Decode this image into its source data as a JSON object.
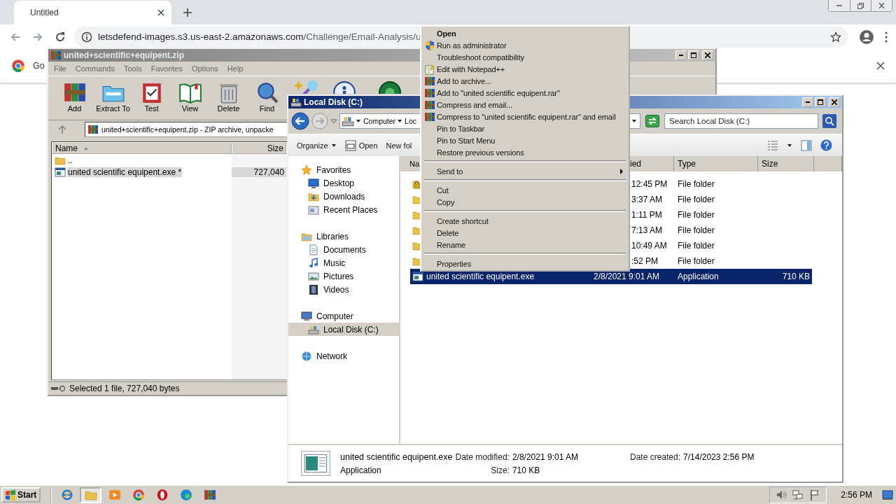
{
  "browser": {
    "tab": {
      "title": "Untitled"
    },
    "address": {
      "host": "letsdefend-images.s3.us-east-2.amazonaws.com",
      "path": "/Challenge/Email-Analysis/u"
    },
    "infobar": {
      "text": "Go"
    }
  },
  "archiver": {
    "title": "united+scientific+equipent.zip",
    "active": false,
    "menu": [
      "File",
      "Commands",
      "Tools",
      "Favorites",
      "Options",
      "Help"
    ],
    "toolbar": [
      {
        "kind": "add",
        "label": "Add"
      },
      {
        "kind": "extract",
        "label": "Extract To"
      },
      {
        "kind": "test",
        "label": "Test"
      },
      {
        "kind": "view",
        "label": "View"
      },
      {
        "kind": "delete",
        "label": "Delete"
      },
      {
        "kind": "find",
        "label": "Find"
      },
      {
        "kind": "wizard"
      },
      {
        "kind": "info"
      },
      {
        "kind": "virus"
      }
    ],
    "path": "united+scientific+equipent.zip - ZIP archive, unpacke",
    "columns": [
      "Name",
      "Size"
    ],
    "rows": [
      {
        "kind": "folder",
        "name": "..",
        "selected": false
      },
      {
        "kind": "app",
        "name": "united scientific equipent.exe *",
        "size": "727,040",
        "selected": true
      }
    ],
    "status": "Selected 1 file, 727,040 bytes"
  },
  "explorer": {
    "title": "Local Disk (C:)",
    "active": true,
    "breadcrumb": [
      "Computer",
      "Loc"
    ],
    "search": {
      "placeholder": "Search Local Disk (C:)"
    },
    "commands": [
      {
        "kind": "menu",
        "label": "Organize"
      },
      {
        "kind": "open",
        "label": "Open"
      },
      {
        "kind": "plain",
        "label": "New fol"
      }
    ],
    "nav": [
      {
        "kind": "favorites",
        "label": "Favorites",
        "selected": false,
        "children": [
          {
            "kind": "desktop",
            "label": "Desktop",
            "selected": false
          },
          {
            "kind": "downloads",
            "label": "Downloads",
            "selected": false
          },
          {
            "kind": "recent",
            "label": "Recent Places",
            "selected": false
          }
        ]
      },
      {
        "kind": "libraries",
        "label": "Libraries",
        "selected": false,
        "children": [
          {
            "kind": "documents",
            "label": "Documents",
            "selected": false
          },
          {
            "kind": "music",
            "label": "Music",
            "selected": false
          },
          {
            "kind": "pictures",
            "label": "Pictures",
            "selected": false
          },
          {
            "kind": "videos",
            "label": "Videos",
            "selected": false
          }
        ]
      },
      {
        "kind": "computer",
        "label": "Computer",
        "selected": false,
        "children": [
          {
            "kind": "drive",
            "label": "Local Disk (C:)",
            "selected": true
          }
        ]
      },
      {
        "kind": "network",
        "label": "Network",
        "selected": false
      }
    ],
    "columns": [
      "Na",
      "ied",
      "Type",
      "Size"
    ],
    "rows": [
      {
        "kind": "locked",
        "modified": "12:45 PM",
        "type": "File folder",
        "selected": false
      },
      {
        "kind": "folder",
        "modified": "3:37 AM",
        "type": "File folder",
        "selected": false
      },
      {
        "kind": "folder",
        "modified": "1:11 PM",
        "type": "File folder",
        "selected": false
      },
      {
        "kind": "folder",
        "modified": "7:13 AM",
        "type": "File folder",
        "selected": false
      },
      {
        "kind": "folder",
        "modified": "10:49 AM",
        "type": "File folder",
        "selected": false
      },
      {
        "kind": "folder",
        "modified": ":52 PM",
        "type": "File folder",
        "selected": false
      },
      {
        "kind": "app",
        "name": "united scientific equipent.exe",
        "modified": "2/8/2021 9:01 AM",
        "type": "Application",
        "size": "710 KB",
        "selected": true
      }
    ],
    "details": {
      "name": "united scientific equipent.exe",
      "type": "Application",
      "fields": [
        {
          "label": "Date modified:",
          "value": "2/8/2021 9:01 AM"
        },
        {
          "label": "Date created:",
          "value": "7/14/2023 2:56 PM"
        },
        {
          "label": "Size:",
          "value": "710 KB"
        }
      ]
    }
  },
  "context_menu": {
    "items": [
      {
        "kind": "plain",
        "label": "Open",
        "default": true
      },
      {
        "kind": "elevated",
        "label": "Run as administrator",
        "default": false
      },
      {
        "kind": "plain",
        "label": "Troubleshoot compatibility",
        "default": false
      },
      {
        "kind": "editor",
        "label": "Edit with Notepad++",
        "default": false
      },
      {
        "kind": "archive",
        "label": "Add to archive...",
        "default": false
      },
      {
        "kind": "archive",
        "label": "Add to \"united scientific equipent.rar\"",
        "default": false
      },
      {
        "kind": "archive",
        "label": "Compress and email...",
        "default": false
      },
      {
        "kind": "archive",
        "label": "Compress to \"united scientific equipent.rar\" and email",
        "default": false
      },
      {
        "kind": "plain",
        "label": "Pin to Taskbar",
        "default": false
      },
      {
        "kind": "plain",
        "label": "Pin to Start Menu",
        "default": false
      },
      {
        "kind": "plain",
        "label": "Restore previous versions",
        "default": false
      },
      {
        "kind": "separator"
      },
      {
        "kind": "submenu",
        "label": "Send to",
        "default": false
      },
      {
        "kind": "separator"
      },
      {
        "kind": "plain",
        "label": "Cut",
        "default": false
      },
      {
        "kind": "plain",
        "label": "Copy",
        "default": false
      },
      {
        "kind": "separator"
      },
      {
        "kind": "plain",
        "label": "Create shortcut",
        "default": false
      },
      {
        "kind": "plain",
        "label": "Delete",
        "default": false
      },
      {
        "kind": "plain",
        "label": "Rename",
        "default": false
      },
      {
        "kind": "separator"
      },
      {
        "kind": "plain",
        "label": "Properties",
        "default": false
      }
    ]
  },
  "taskbar": {
    "start": "Start",
    "apps": [
      {
        "kind": "ie",
        "selected": false
      },
      {
        "kind": "folder",
        "selected": true
      },
      {
        "kind": "media",
        "selected": false
      },
      {
        "kind": "chrome",
        "selected": false
      },
      {
        "kind": "opera",
        "selected": false
      },
      {
        "kind": "edge",
        "selected": false
      },
      {
        "kind": "rar",
        "selected": false
      }
    ],
    "clock": "2:56 PM"
  }
}
